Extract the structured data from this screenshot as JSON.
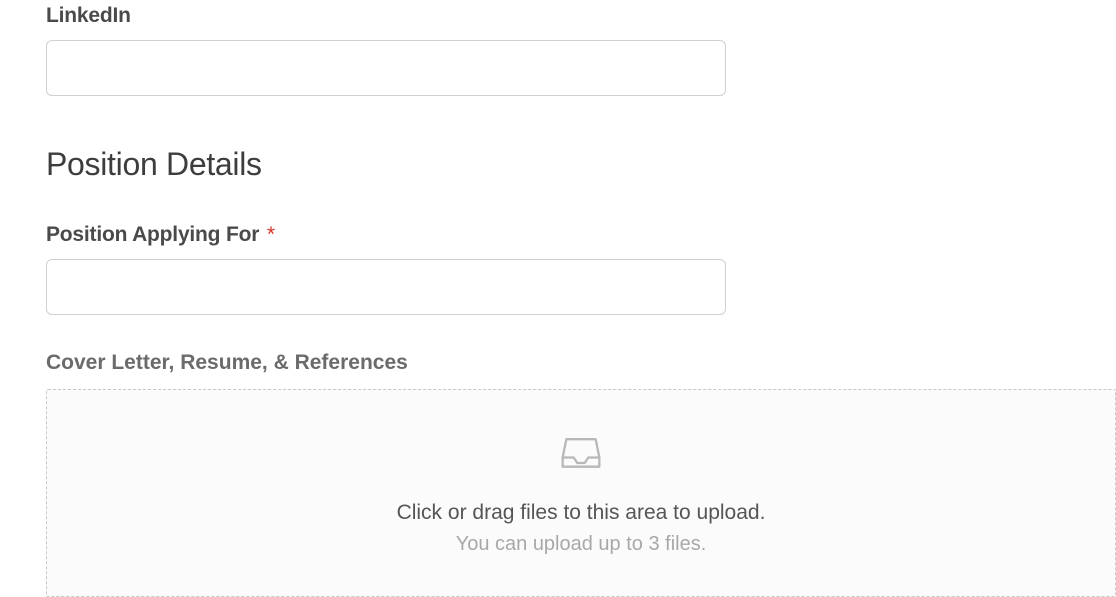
{
  "fields": {
    "linkedin": {
      "label": "LinkedIn",
      "value": ""
    },
    "position_details_heading": "Position Details",
    "position_applying": {
      "label": "Position Applying For",
      "required_mark": "*",
      "value": ""
    },
    "upload": {
      "label": "Cover Letter, Resume, & References",
      "primary_text": "Click or drag files to this area to upload.",
      "secondary_text": "You can upload up to 3 files."
    }
  }
}
